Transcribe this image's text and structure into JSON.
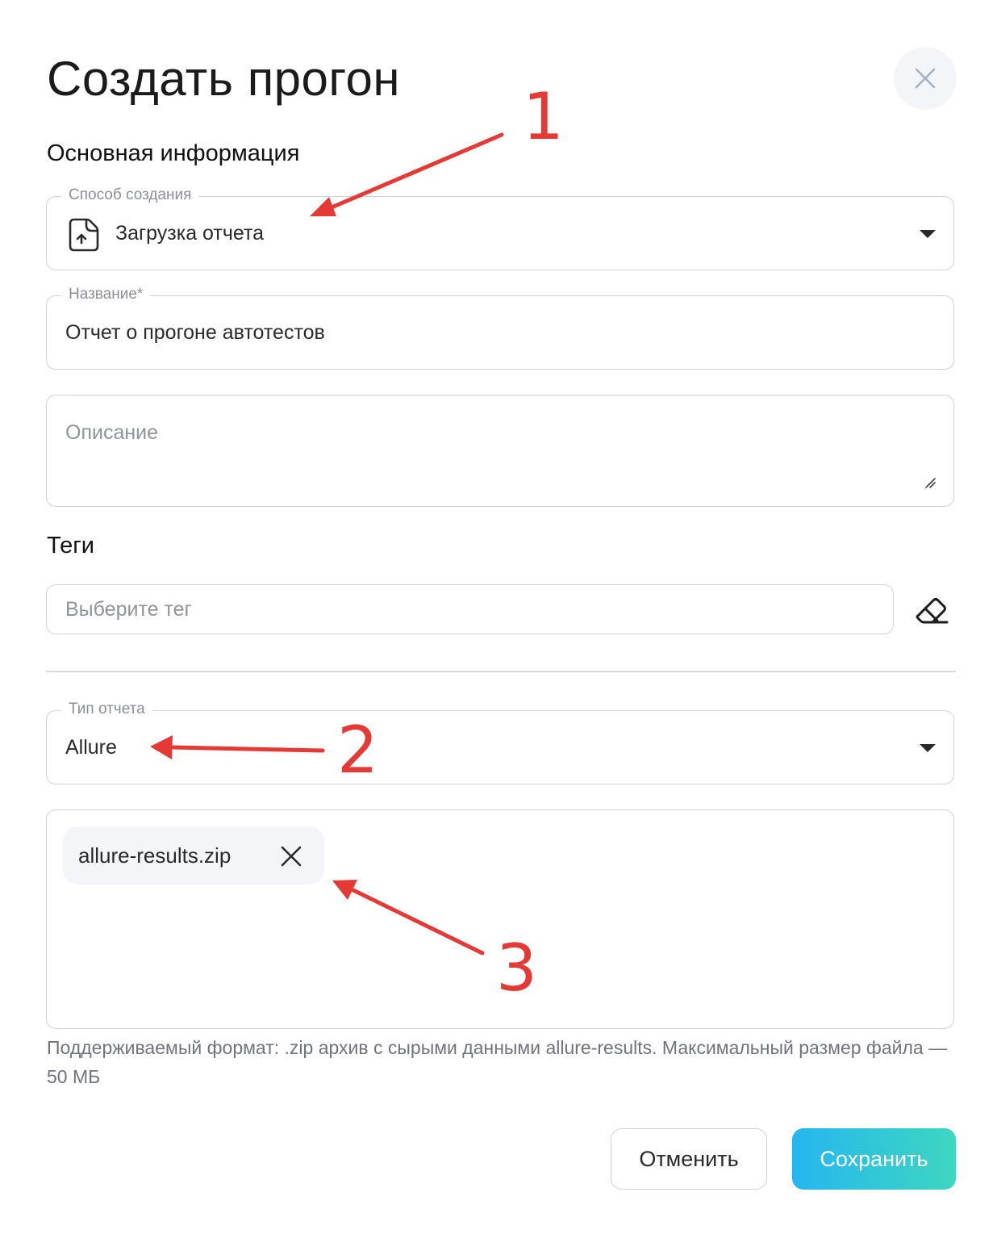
{
  "dialog": {
    "title": "Создать прогон",
    "close_icon": "close-icon"
  },
  "basic_info": {
    "section_title": "Основная информация",
    "creation_method": {
      "label": "Способ создания",
      "value": "Загрузка отчета",
      "icon": "file-upload-icon"
    },
    "name": {
      "label": "Название*",
      "value": "Отчет о прогоне автотестов"
    },
    "description": {
      "placeholder": "Описание",
      "value": ""
    }
  },
  "tags": {
    "section_title": "Теги",
    "placeholder": "Выберите тег",
    "clear_icon": "eraser-icon"
  },
  "report": {
    "type": {
      "label": "Тип отчета",
      "value": "Allure"
    },
    "file": {
      "name": "allure-results.zip",
      "remove_icon": "close-icon"
    },
    "hint": "Поддерживаемый формат: .zip архив с сырыми данными allure-results. Максимальный размер файла — 50 МБ"
  },
  "actions": {
    "cancel_label": "Отменить",
    "save_label": "Сохранить"
  },
  "annotations": {
    "color": "#e53935",
    "numbers": [
      "1",
      "2",
      "3"
    ]
  },
  "colors": {
    "accent_start": "#26b6f0",
    "accent_end": "#3dd6bf",
    "border": "#cfd3d9"
  }
}
